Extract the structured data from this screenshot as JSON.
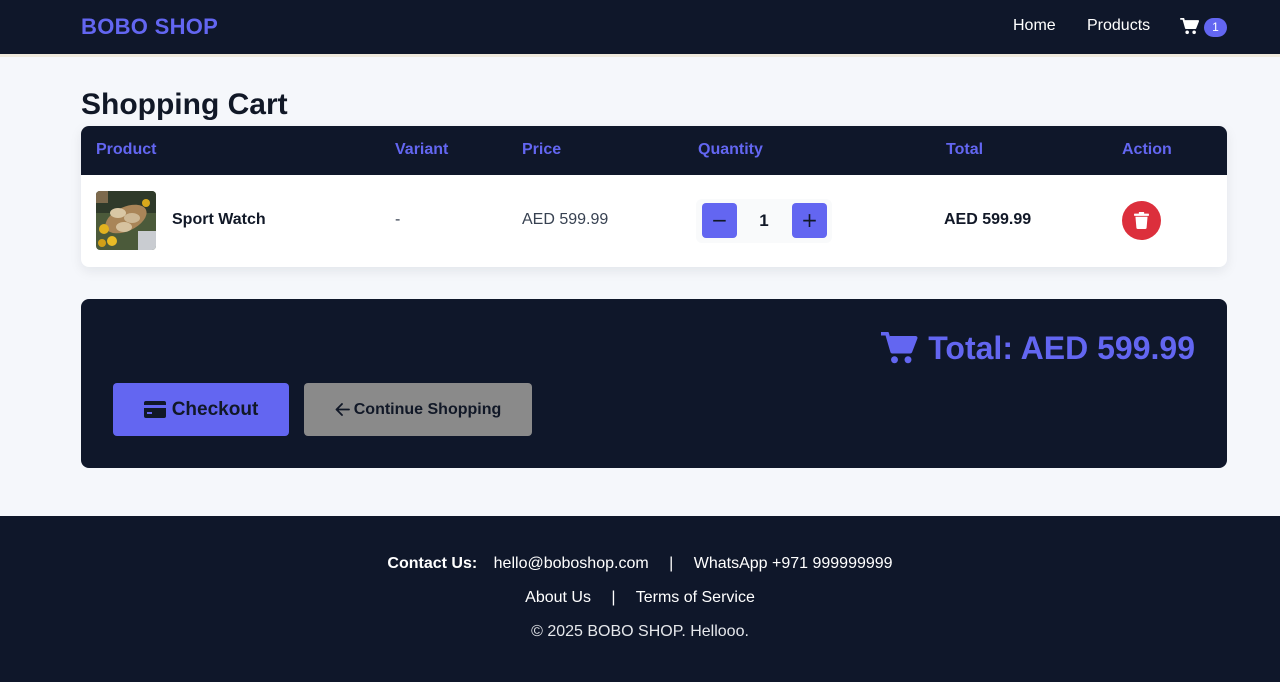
{
  "nav": {
    "brand": "BOBO SHOP",
    "home_label": "Home",
    "products_label": "Products",
    "cart_count": "1",
    "cart_icon": "shopping-cart-icon"
  },
  "page": {
    "title": "Shopping Cart"
  },
  "table": {
    "headers": {
      "product": "Product",
      "variant": "Variant",
      "price": "Price",
      "quantity": "Quantity",
      "total": "Total",
      "action": "Action"
    },
    "rows": [
      {
        "name": "Sport Watch",
        "variant": "-",
        "price": "AED 599.99",
        "quantity": "1",
        "minus_label": "−",
        "plus_label": "+",
        "total": "AED 599.99",
        "delete_icon": "trash-icon"
      }
    ]
  },
  "summary": {
    "total_label": "Total: AED 599.99",
    "checkout_label": "Checkout",
    "continue_label": "Continue Shopping",
    "colors": {
      "accent": "#6366f1",
      "danger": "#dc2f3c",
      "dark": "#0f172a",
      "muted_button": "#8a8a8a"
    }
  },
  "footer": {
    "contact_label": "Contact Us:",
    "email": "hello@boboshop.com",
    "separator": "|",
    "whatsapp": "WhatsApp +971 999999999",
    "about": "About Us",
    "terms": "Terms of Service",
    "copyright": "© 2025 BOBO SHOP. Hellooo."
  }
}
